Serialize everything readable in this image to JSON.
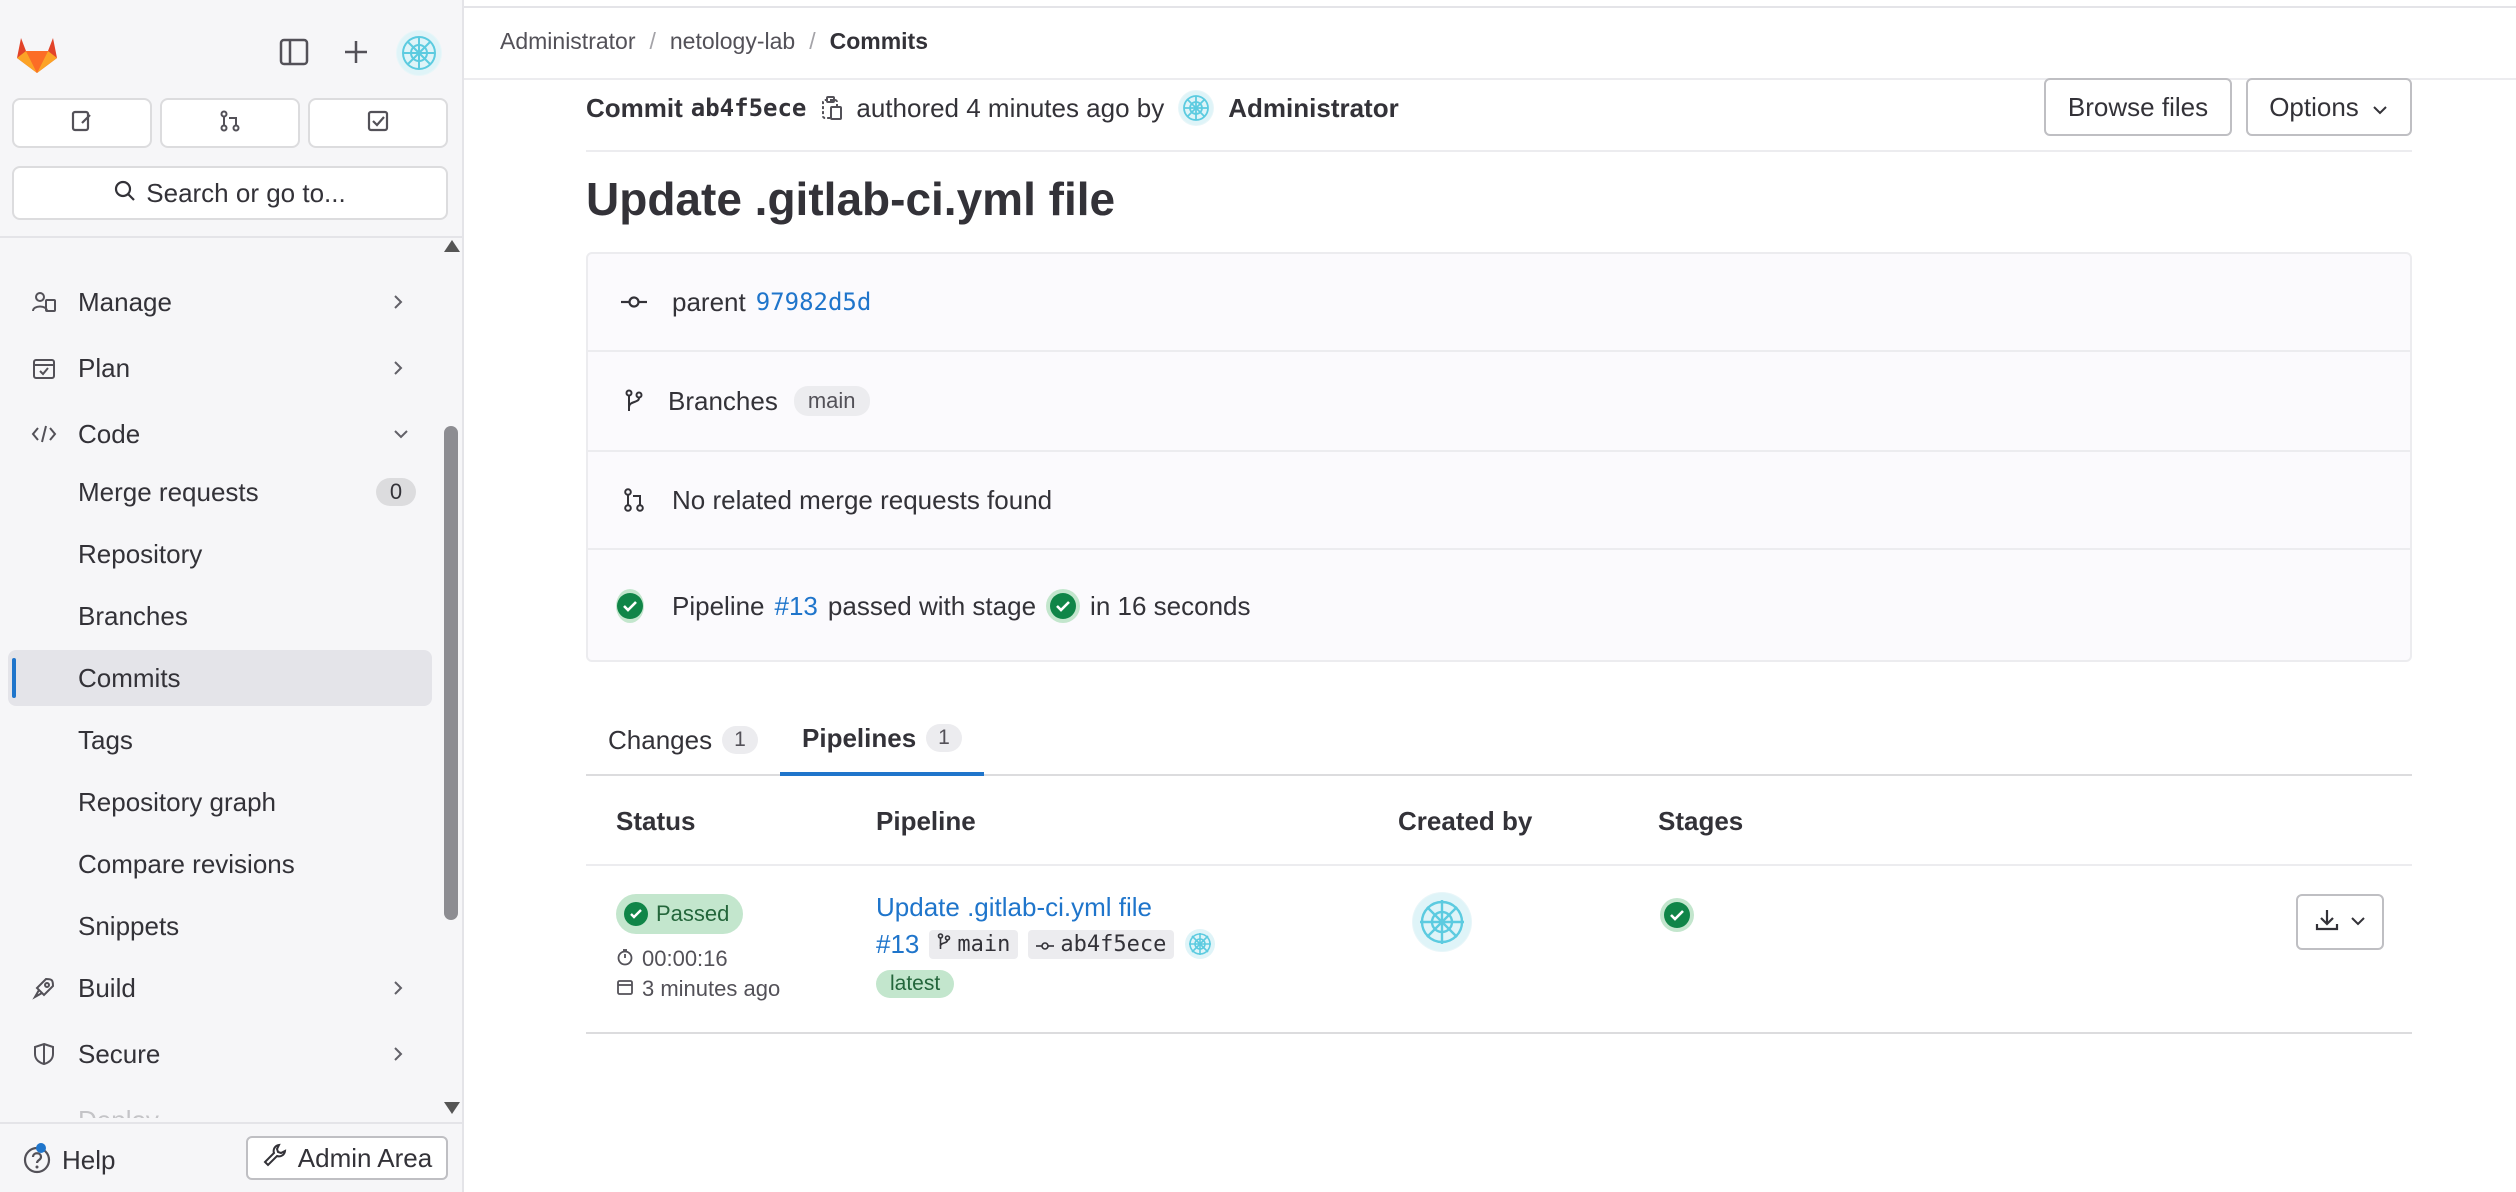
{
  "sidebar": {
    "search_label": "Search or go to...",
    "nav": {
      "manage": "Manage",
      "plan": "Plan",
      "code": "Code",
      "merge_requests": "Merge requests",
      "merge_requests_count": "0",
      "repository": "Repository",
      "branches": "Branches",
      "commits": "Commits",
      "tags": "Tags",
      "repository_graph": "Repository graph",
      "compare_revisions": "Compare revisions",
      "snippets": "Snippets",
      "build": "Build",
      "secure": "Secure",
      "deploy_partial": "Deploy"
    },
    "help_label": "Help",
    "admin_label": "Admin Area"
  },
  "breadcrumb": {
    "items": [
      "Administrator",
      "netology-lab",
      "Commits"
    ]
  },
  "commit": {
    "label": "Commit",
    "sha": "ab4f5ece",
    "authored_text": "authored 4 minutes ago by",
    "author": "Administrator",
    "title": "Update .gitlab-ci.yml file",
    "browse_files": "Browse files",
    "options": "Options",
    "parent_label": "parent",
    "parent_sha": "97982d5d",
    "branches_label": "Branches",
    "branch": "main",
    "mr_text": "No related merge requests found",
    "pipeline_prefix": "Pipeline",
    "pipeline_id": "#13",
    "pipeline_mid": "passed with stage",
    "pipeline_suffix": "in 16 seconds"
  },
  "tabs": [
    {
      "label": "Changes",
      "count": "1"
    },
    {
      "label": "Pipelines",
      "count": "1"
    }
  ],
  "table": {
    "headers": {
      "status": "Status",
      "pipeline": "Pipeline",
      "created_by": "Created by",
      "stages": "Stages"
    },
    "row": {
      "status": "Passed",
      "duration": "00:00:16",
      "finished": "3 minutes ago",
      "title": "Update .gitlab-ci.yml file",
      "id": "#13",
      "ref": "main",
      "sha": "ab4f5ece",
      "badge": "latest"
    }
  },
  "colors": {
    "accent": "#1f75cb",
    "success": "#108548",
    "success_bg": "#c3e6cd",
    "brand_orange": "#e24329"
  },
  "icons": [
    "gitlab-logo",
    "sidebar-toggle-icon",
    "plus-icon",
    "issues-icon",
    "merge-request-icon",
    "todo-icon",
    "search-icon",
    "chevron-right-icon",
    "chevron-down-icon",
    "copy-icon",
    "commit-icon",
    "branch-icon",
    "check-circle-icon",
    "clock-icon",
    "calendar-icon",
    "download-icon",
    "help-icon",
    "admin-wrench-icon"
  ]
}
